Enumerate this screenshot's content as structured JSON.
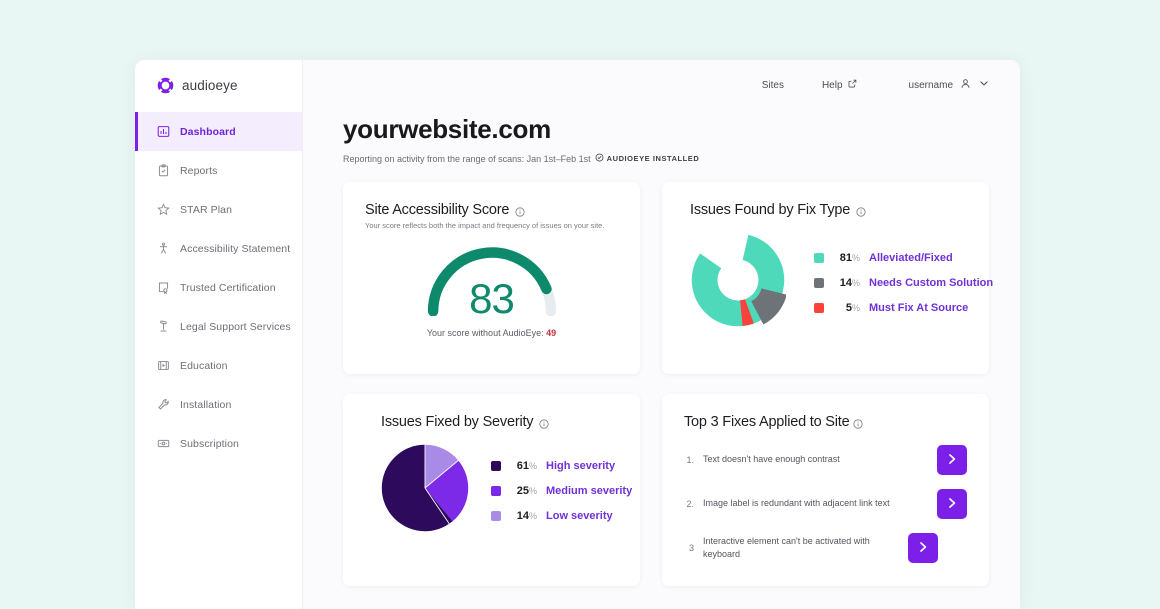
{
  "colors": {
    "page_background": "#e9f7f4",
    "accent_purple": "#7c1fe8",
    "score_green": "#0d8a6b",
    "danger_red": "#c2343f"
  },
  "brand": {
    "name": "audioeye",
    "logo_icon": "audioeye-ring-logo"
  },
  "sidebar": {
    "items": [
      {
        "label": "Dashboard",
        "icon": "bar-chart-icon",
        "active": true
      },
      {
        "label": "Reports",
        "icon": "clipboard-check-icon",
        "active": false
      },
      {
        "label": "STAR Plan",
        "icon": "star-icon",
        "active": false
      },
      {
        "label": "Accessibility Statement",
        "icon": "accessibility-person-icon",
        "active": false
      },
      {
        "label": "Trusted Certification",
        "icon": "certificate-badge-icon",
        "active": false
      },
      {
        "label": "Legal Support Services",
        "icon": "gavel-icon",
        "active": false
      },
      {
        "label": "Education",
        "icon": "video-play-icon",
        "active": false
      },
      {
        "label": "Installation",
        "icon": "wrench-icon",
        "active": false
      },
      {
        "label": "Subscription",
        "icon": "card-payment-icon",
        "active": false
      }
    ]
  },
  "topbar": {
    "sites_label": "Sites",
    "help_label": "Help",
    "help_icon": "external-link-icon",
    "username": "username",
    "user_icon": "person-icon",
    "chevron_icon": "chevron-down-icon"
  },
  "header": {
    "title": "yourwebsite.com",
    "subtitle": "Reporting on activity from the range of scans: Jan 1st–Feb 1st",
    "installed_badge": "AUDIOEYE INSTALLED",
    "installed_icon": "check-circle-icon"
  },
  "cards": {
    "score": {
      "title": "Site Accessibility Score",
      "info_icon": "info-icon",
      "subtitle": "Your score reflects both the impact and frequency of issues on your site.",
      "value": "83",
      "footer_prefix": "Your score without AudioEye:",
      "footer_value": "49"
    },
    "fix_type": {
      "title": "Issues Found by Fix Type",
      "info_icon": "info-icon"
    },
    "severity": {
      "title": "Issues Fixed by Severity",
      "info_icon": "info-icon"
    },
    "top_fixes": {
      "title": "Top 3 Fixes Applied to Site",
      "info_icon": "info-icon",
      "items": [
        {
          "num": "1.",
          "text": "Text doesn't have enough contrast",
          "action_icon": "chevron-right-icon"
        },
        {
          "num": "2.",
          "text": "Image label is redundant with adjacent link text",
          "action_icon": "chevron-right-icon"
        },
        {
          "num": "3",
          "text": "Interactive element can't be activated with keyboard",
          "action_icon": "chevron-right-icon"
        }
      ]
    }
  },
  "chart_data": [
    {
      "type": "gauge",
      "title": "Site Accessibility Score",
      "value": 83,
      "min": 0,
      "max": 100,
      "comparison_label": "Your score without AudioEye",
      "comparison_value": 49,
      "arc_color": "#0d8a6b",
      "track_color": "#e7ecf0"
    },
    {
      "type": "pie",
      "title": "Issues Found by Fix Type",
      "variant": "donut",
      "labels": [
        "Alleviated/Fixed",
        "Needs Custom Solution",
        "Must Fix At Source"
      ],
      "values": [
        81,
        14,
        5
      ],
      "value_suffix": "%",
      "colors": [
        "#4fd9bb",
        "#6e7378",
        "#f9423a"
      ],
      "exploded_slice": "Needs Custom Solution",
      "legend_position": "right"
    },
    {
      "type": "pie",
      "title": "Issues Fixed by Severity",
      "labels": [
        "High severity",
        "Medium severity",
        "Low severity"
      ],
      "values": [
        61,
        25,
        14
      ],
      "value_suffix": "%",
      "colors": [
        "#2e0a5c",
        "#7c2ae8",
        "#a98ae6"
      ],
      "legend_position": "right"
    }
  ]
}
